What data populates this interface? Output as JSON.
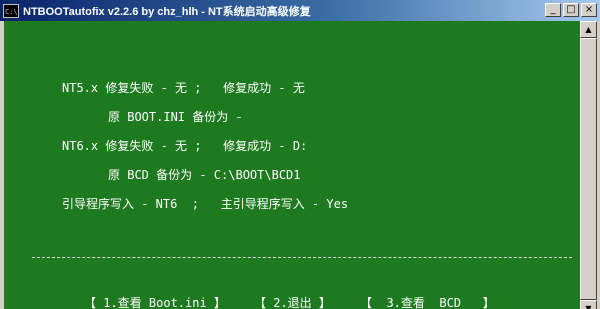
{
  "window": {
    "icon_text": "C:\\",
    "title": "NTBOOTautofix v2.2.6 by chz_hlh - NT系统启动高级修复",
    "minimize_glyph": "_",
    "maximize_glyph": "□",
    "close_glyph": "×"
  },
  "console": {
    "lines": [
      "NT5.x 修复失败 - 无 ;   修复成功 - 无",
      "原 BOOT.INI 备份为 -",
      "NT6.x 修复失败 - 无 ;   修复成功 - D:",
      "原 BCD 备份为 - C:\\BOOT\\BCD1",
      "引导程序写入 - NT6  ;   主引导程序写入 - Yes"
    ],
    "menu": [
      "【 1.查看 Boot.ini 】",
      "【 2.退出 】",
      "【  3.查看  BCD   】"
    ]
  },
  "scrollbar": {
    "up_glyph": "▲",
    "down_glyph": "▼"
  },
  "colors": {
    "console_bg": "#1e7a1e",
    "console_fg": "#ffffff",
    "titlebar_start": "#0a246a",
    "titlebar_end": "#a6caf0"
  }
}
